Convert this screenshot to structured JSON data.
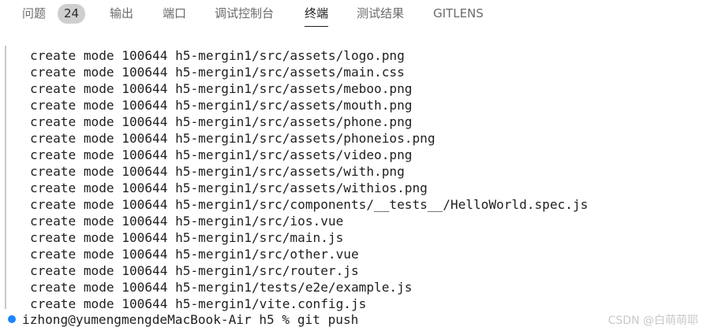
{
  "panel": {
    "tabs": [
      {
        "label": "问题",
        "active": false
      },
      {
        "label": "输出",
        "active": false
      },
      {
        "label": "端口",
        "active": false
      },
      {
        "label": "调试控制台",
        "active": false
      },
      {
        "label": "终端",
        "active": true
      },
      {
        "label": "测试结果",
        "active": false
      },
      {
        "label": "GITLENS",
        "active": false
      }
    ],
    "problems_count": "24"
  },
  "terminal": {
    "lines": [
      "create mode 100644 h5-mergin1/src/assets/logo.png",
      "create mode 100644 h5-mergin1/src/assets/main.css",
      "create mode 100644 h5-mergin1/src/assets/meboo.png",
      "create mode 100644 h5-mergin1/src/assets/mouth.png",
      "create mode 100644 h5-mergin1/src/assets/phone.png",
      "create mode 100644 h5-mergin1/src/assets/phoneios.png",
      "create mode 100644 h5-mergin1/src/assets/video.png",
      "create mode 100644 h5-mergin1/src/assets/with.png",
      "create mode 100644 h5-mergin1/src/assets/withios.png",
      "create mode 100644 h5-mergin1/src/components/__tests__/HelloWorld.spec.js",
      "create mode 100644 h5-mergin1/src/ios.vue",
      "create mode 100644 h5-mergin1/src/main.js",
      "create mode 100644 h5-mergin1/src/other.vue",
      "create mode 100644 h5-mergin1/src/router.js",
      "create mode 100644 h5-mergin1/tests/e2e/example.js",
      "create mode 100644 h5-mergin1/vite.config.js"
    ],
    "prompt": "izhong@yumengmengdeMacBook-Air h5 % git push",
    "prompt_marker_color": "#1a85ff"
  },
  "watermark": "CSDN @白萌萌耶"
}
